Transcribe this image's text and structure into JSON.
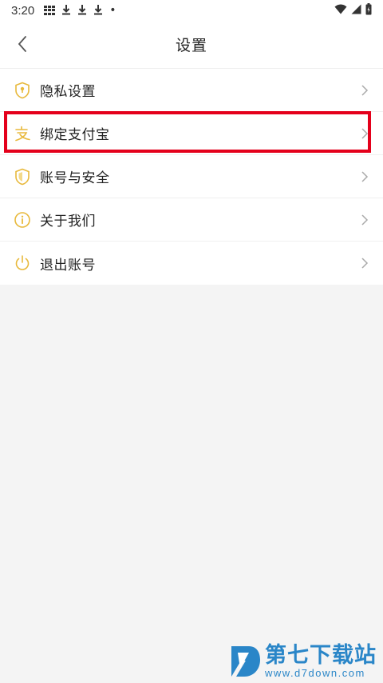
{
  "status_bar": {
    "time": "3:20",
    "dot": "•"
  },
  "header": {
    "title": "设置"
  },
  "menu": {
    "items": [
      {
        "label": "隐私设置",
        "icon": "privacy-shield-icon"
      },
      {
        "label": "绑定支付宝",
        "icon": "alipay-icon"
      },
      {
        "label": "账号与安全",
        "icon": "security-shield-icon"
      },
      {
        "label": "关于我们",
        "icon": "info-icon"
      },
      {
        "label": "退出账号",
        "icon": "power-icon"
      }
    ]
  },
  "colors": {
    "icon_accent": "#e8b93c",
    "highlight": "#e4001b",
    "watermark": "#2a86c8"
  },
  "watermark": {
    "brand": "第七下载站",
    "url": "www.d7down.com"
  }
}
